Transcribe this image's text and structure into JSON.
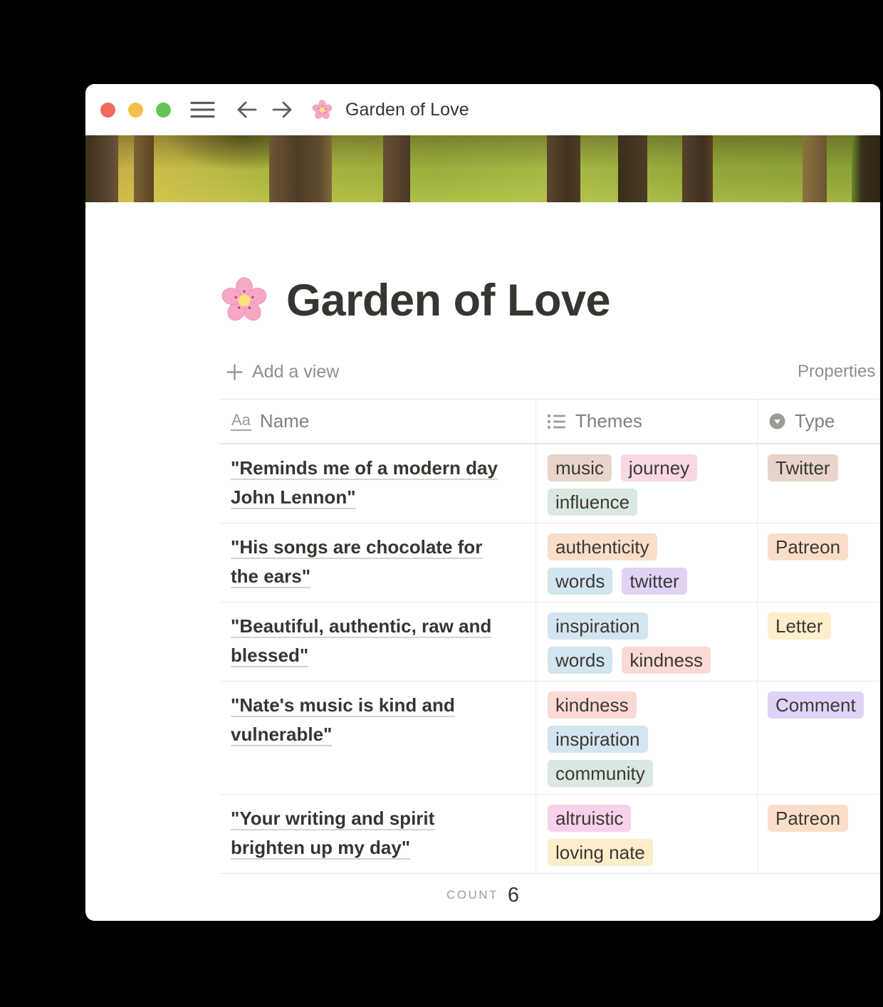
{
  "titlebar": {
    "traffic_lights": [
      {
        "name": "close",
        "color": "#ed6a5f"
      },
      {
        "name": "minimize",
        "color": "#f5bf4f"
      },
      {
        "name": "zoom",
        "color": "#61c554"
      }
    ],
    "emoji": "🌸",
    "title": "Garden of Love"
  },
  "page": {
    "emoji": "🌸",
    "title": "Garden of Love",
    "add_view_label": "Add a view",
    "properties_label": "Properties"
  },
  "table": {
    "columns": [
      {
        "label": "Name",
        "icon": "title-icon"
      },
      {
        "label": "Themes",
        "icon": "multi-select-icon"
      },
      {
        "label": "Type",
        "icon": "select-icon"
      }
    ],
    "rows": [
      {
        "name": "\"Reminds me of a modern day John Lennon\"",
        "themes_lines": [
          [
            {
              "label": "music",
              "color": "brown"
            },
            {
              "label": "journey",
              "color": "pink"
            }
          ],
          [
            {
              "label": "influence",
              "color": "green"
            }
          ]
        ],
        "type": {
          "label": "Twitter",
          "color": "brown"
        }
      },
      {
        "name": "\"His songs are chocolate for the ears\"",
        "themes_lines": [
          [
            {
              "label": "authenticity",
              "color": "orange"
            }
          ],
          [
            {
              "label": "words",
              "color": "blue"
            },
            {
              "label": "twitter",
              "color": "purple"
            }
          ]
        ],
        "type": {
          "label": "Patreon",
          "color": "orange"
        }
      },
      {
        "name": "\"Beautiful, authentic, raw and blessed\"",
        "themes_lines": [
          [
            {
              "label": "inspiration",
              "color": "blue"
            }
          ],
          [
            {
              "label": "words",
              "color": "blue"
            },
            {
              "label": "kindness",
              "color": "red"
            }
          ]
        ],
        "type": {
          "label": "Letter",
          "color": "yellow"
        }
      },
      {
        "name": "\"Nate's music is kind and vulnerable\"",
        "themes_lines": [
          [
            {
              "label": "kindness",
              "color": "red"
            }
          ],
          [
            {
              "label": "inspiration",
              "color": "blue"
            }
          ],
          [
            {
              "label": "community",
              "color": "green"
            }
          ]
        ],
        "type": {
          "label": "Comment",
          "color": "purple"
        }
      },
      {
        "name": "\"Your writing and spirit brighten up my day\"",
        "themes_lines": [
          [
            {
              "label": "altruistic",
              "color": "magenta"
            }
          ],
          [
            {
              "label": "loving nate",
              "color": "yellow"
            }
          ]
        ],
        "type": {
          "label": "Patreon",
          "color": "orange"
        }
      }
    ],
    "footer": {
      "count_label": "COUNT",
      "count_value": "6"
    }
  },
  "tag_colors": {
    "brown": "#e7d4ca",
    "pink": "#f9d7e5",
    "green": "#dbe7e1",
    "orange": "#fadeca",
    "blue": "#d3e5ef",
    "purple": "#e0d3f6",
    "red": "#fbd9d4",
    "yellow": "#fcedcb",
    "magenta": "#f7d2ea"
  }
}
